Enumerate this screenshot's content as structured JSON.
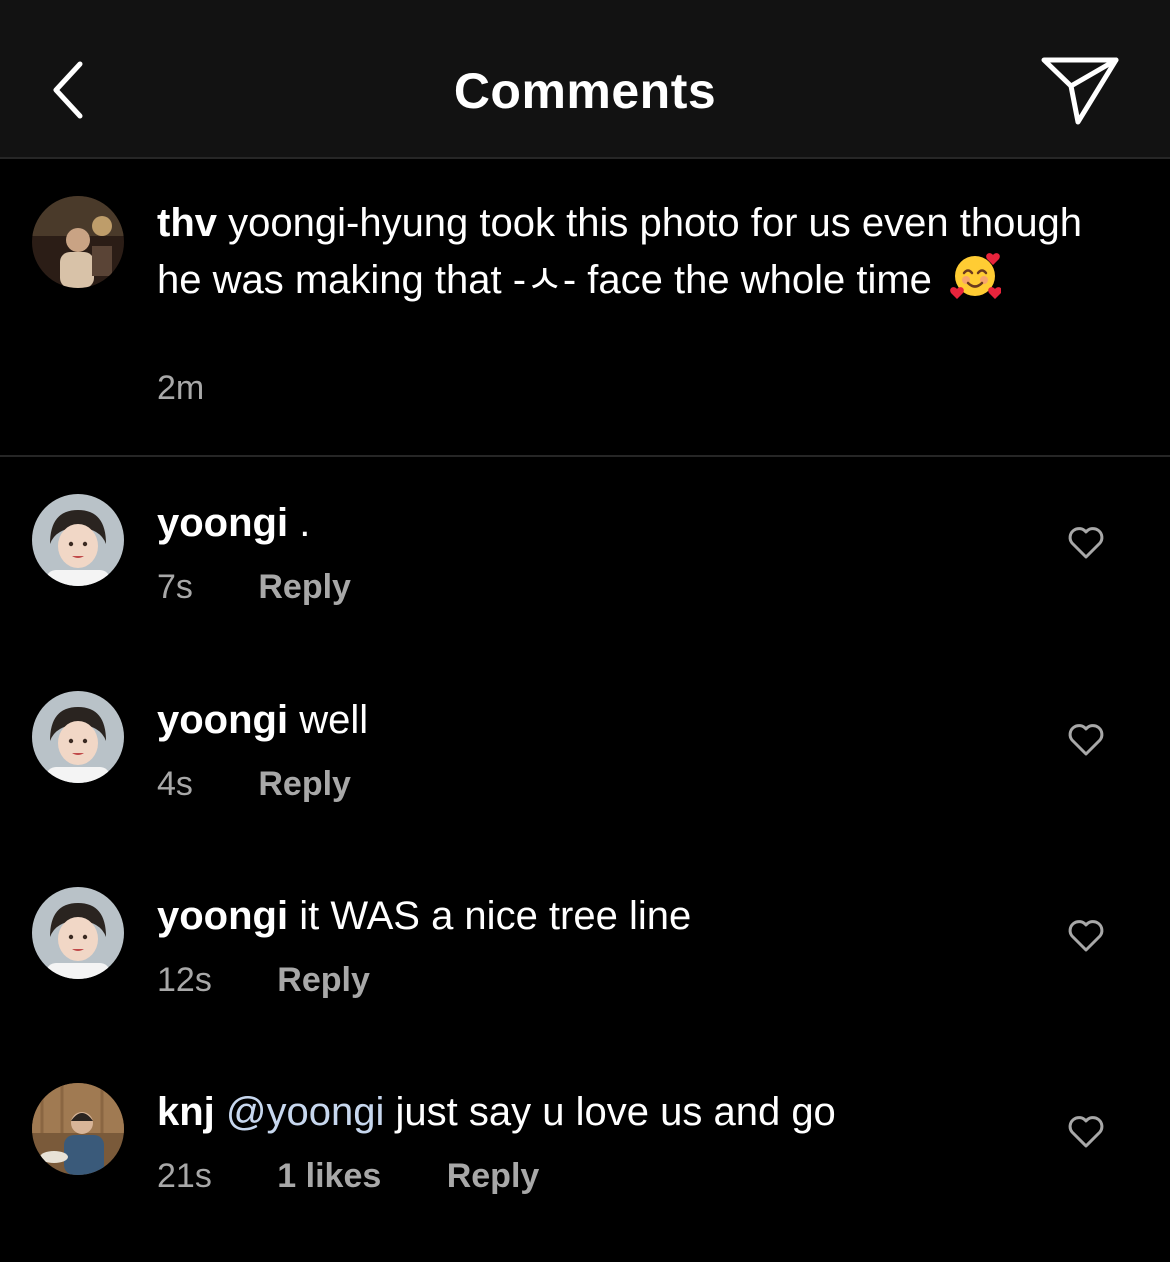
{
  "header": {
    "title": "Comments",
    "back_icon": "chevron-left-icon",
    "share_icon": "paper-plane-icon"
  },
  "caption": {
    "username": "thv",
    "text": "yoongi-hyung took this photo for us even though he was making that -ㅅ- face the whole time",
    "emoji": "smiling-face-with-hearts-emoji",
    "time": "2m"
  },
  "comments": [
    {
      "username": "yoongi",
      "text": ".",
      "time": "7s",
      "likes": "",
      "reply": "Reply"
    },
    {
      "username": "yoongi",
      "text": "well",
      "time": "4s",
      "likes": "",
      "reply": "Reply"
    },
    {
      "username": "yoongi",
      "text": "it WAS a nice tree line",
      "time": "12s",
      "likes": "",
      "reply": "Reply"
    },
    {
      "username": "knj",
      "mention": "@yoongi",
      "text": "just say u love us and go",
      "time": "21s",
      "likes": "1 likes",
      "reply": "Reply"
    }
  ],
  "colors": {
    "background": "#000000",
    "header_background": "#121212",
    "divider": "#262626",
    "secondary_text": "#a8a8a8",
    "primary_text": "#ffffff"
  }
}
